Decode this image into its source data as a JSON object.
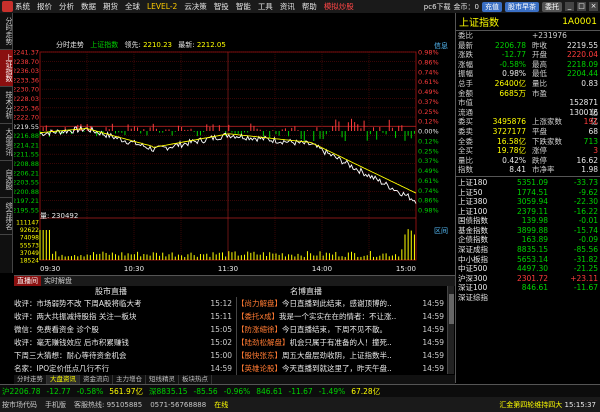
{
  "menu": [
    "系统",
    "报价",
    "分析",
    "数据",
    "期货",
    "全球",
    "LEVEL-2",
    "云决策",
    "智投",
    "智能",
    "工具",
    "资讯",
    "帮助",
    "模拟炒股"
  ],
  "menu_right": {
    "text1": "pc6下载",
    "text2": "金币：0",
    "btn1": "充值",
    "btn2": "股市早茶",
    "btn3": "委托"
  },
  "left_tabs": [
    "分时走势",
    "上证指数",
    "技术分析",
    "大盘资讯",
    "自选股",
    "综合排名"
  ],
  "chart": {
    "header": {
      "label1": "分时走势",
      "label2": "上证指数",
      "label3": "领先:",
      "value3": "2210.23",
      "label4": "最新:",
      "value4": "2212.05"
    },
    "top_right": "信息",
    "zoom": "区间",
    "price_ticks": [
      "2241.37",
      "2238.70",
      "2236.03",
      "2233.36",
      "2230.70",
      "2228.03",
      "2225.36",
      "2222.70",
      "2219.55",
      "2216.88",
      "2214.21",
      "2211.55",
      "2208.88",
      "2206.21",
      "2203.55",
      "2200.88",
      "2197.21",
      "2195.55"
    ],
    "pct_ticks": [
      "0.98%",
      "0.86%",
      "0.74%",
      "0.61%",
      "0.49%",
      "0.37%",
      "0.25%",
      "0.12%",
      "0.00%",
      "0.12%",
      "0.25%",
      "0.37%",
      "0.49%",
      "0.61%",
      "0.74%",
      "0.86%",
      "0.98%"
    ],
    "vol_label": "量: 230492",
    "vol_ticks": [
      "111147",
      "92622",
      "74098",
      "55573",
      "37049",
      "18524"
    ],
    "time_ticks": [
      "09:30",
      "10:30",
      "11:30",
      "14:00",
      "15:00"
    ]
  },
  "right_panel": {
    "title": "上证指数",
    "code": "1A0001",
    "rows": [
      {
        "l": "委比",
        "v": "",
        "l2": "+231976",
        "v2": "",
        "cls": "red",
        "cls2": "red"
      },
      {
        "l": "最新",
        "v": "2206.78",
        "l2": "昨收",
        "v2": "2219.55",
        "cls": "green",
        "cls2": "white"
      },
      {
        "l": "涨跌",
        "v": "-12.77",
        "l2": "开盘",
        "v2": "2220.04",
        "cls": "green",
        "cls2": "red"
      },
      {
        "l": "涨幅",
        "v": "-0.58%",
        "l2": "最高",
        "v2": "2218.09",
        "cls": "green",
        "cls2": "green"
      },
      {
        "l": "振幅",
        "v": "0.98%",
        "l2": "最低",
        "v2": "2204.44",
        "cls": "white",
        "cls2": "green"
      },
      {
        "l": "总手",
        "v": "26400亿",
        "l2": "量比",
        "v2": "0.83",
        "cls": "yellow",
        "cls2": "white"
      },
      {
        "l": "金额",
        "v": "6685万",
        "l2": "市盈",
        "v2": "",
        "cls": "yellow",
        "cls2": "white"
      },
      {
        "l": "市值",
        "v": "",
        "l2": "",
        "v2": "152871亿",
        "cls": "white",
        "cls2": "white"
      },
      {
        "l": "流通",
        "v": "",
        "l2": "",
        "v2": "130016亿",
        "cls": "white",
        "cls2": "white"
      },
      {
        "l": "委买",
        "v": "3495876",
        "l2": "上涨家数",
        "v2": "191",
        "cls": "yellow",
        "cls2": "red"
      },
      {
        "l": "委卖",
        "v": "3727177",
        "l2": "平盘",
        "v2": "68",
        "cls": "yellow",
        "cls2": "white"
      },
      {
        "l": "全委",
        "v": "16.58亿",
        "l2": "下跌家数",
        "v2": "713",
        "cls": "yellow",
        "cls2": "green"
      },
      {
        "l": "全买",
        "v": "19.78亿",
        "l2": "涨停",
        "v2": "3",
        "cls": "yellow",
        "cls2": "red"
      },
      {
        "l": "量比",
        "v": "0.42%",
        "l2": "跌停",
        "v2": "16.62",
        "cls": "white",
        "cls2": "white"
      },
      {
        "l": "指数",
        "v": "8.41",
        "l2": "市净率",
        "v2": "1.98",
        "cls": "white",
        "cls2": "white"
      }
    ],
    "indexes": [
      {
        "n": "上证180",
        "p": "5351.09",
        "c": "-33.73"
      },
      {
        "n": "上证50",
        "p": "1774.51",
        "c": "-9.62"
      },
      {
        "n": "上证380",
        "p": "3059.94",
        "c": "-22.30"
      },
      {
        "n": "上证100",
        "p": "2379.11",
        "c": "-16.22"
      },
      {
        "n": "国债指数",
        "p": "139.98",
        "c": "-0.01"
      },
      {
        "n": "基金指数",
        "p": "3899.88",
        "c": "-15.74"
      },
      {
        "n": "企债指数",
        "p": "163.89",
        "c": "-0.09"
      },
      {
        "n": "深证成指",
        "p": "8835.15",
        "c": "-85.56"
      },
      {
        "n": "中小板指",
        "p": "5653.14",
        "c": "-31.82"
      },
      {
        "n": "中证500",
        "p": "4497.30",
        "c": "-21.25"
      },
      {
        "n": "沪深300",
        "p": "2301.72",
        "c": "+23.11"
      },
      {
        "n": "深证100",
        "p": "846.61",
        "c": "-11.67"
      },
      {
        "n": "深证综指",
        "p": "",
        "c": ""
      }
    ]
  },
  "news_tabs": [
    "直播间",
    "实时解盘"
  ],
  "news_left_title": "股市直播",
  "news_right_title": "名博直播",
  "news_left": [
    {
      "t": "收评：市场弱势不改 下周A股将临大考",
      "tm": "15:12"
    },
    {
      "t": "收评：两大共振减持股指 关注一板块",
      "tm": "15:11"
    },
    {
      "t": "微信：免费看资金 诊个股",
      "tm": "15:05"
    },
    {
      "t": "收评：毫无赚钱效应 后市积累赚钱",
      "tm": "15:02"
    },
    {
      "t": "下周三大猜想：耐心等待资金机会",
      "tm": "15:00"
    },
    {
      "t": "名家：IPO定价低点几行不行",
      "tm": "14:59"
    }
  ],
  "news_right": [
    {
      "tag": "【尚力解盘】",
      "t": "今日直播到此结束，感谢顶博的..",
      "tm": "14:59"
    },
    {
      "tag": "【委托x成】",
      "t": "我是一个实实在在的情者：不让涨..",
      "tm": "14:59"
    },
    {
      "tag": "【防涨缩徐】",
      "t": "今日直播结束，下周不见不散。",
      "tm": "14:59"
    },
    {
      "tag": "【陆劲松解盘】",
      "t": "机会只属于有准备的人！撞死..",
      "tm": "14:59"
    },
    {
      "tag": "【股快张东】",
      "t": "周五大盘层劲收阴，上证指数半..",
      "tm": "14:59"
    },
    {
      "tag": "【英雄论股】",
      "t": "今天直播到就这里了，昨天午盘..",
      "tm": "14:59"
    }
  ],
  "bottom_tabs": [
    "分时走势",
    "大盘资讯",
    "资金流向",
    "主力增仓",
    "短线精灵",
    "板块热点"
  ],
  "status1": [
    {
      "t": "沪2206.78",
      "cls": "green"
    },
    {
      "t": "-12.77",
      "cls": "green"
    },
    {
      "t": "-0.58%",
      "cls": "green"
    },
    {
      "t": "561.97亿",
      "cls": "yellow"
    },
    {
      "t": "深8835.15",
      "cls": "green"
    },
    {
      "t": "-85.56",
      "cls": "green"
    },
    {
      "t": "-0.96%",
      "cls": "green"
    },
    {
      "t": "846.61",
      "cls": "green"
    },
    {
      "t": "-11.67",
      "cls": "green"
    },
    {
      "t": "-1.49%",
      "cls": "green"
    },
    {
      "t": "67.28亿",
      "cls": "yellow"
    }
  ],
  "status2": {
    "a": "按市场代码",
    "b": "手机版",
    "c": "客服热线: 95105885",
    "d": "0571-56768888",
    "warn": "在线",
    "right": "汇金第四轮维持四大",
    "time": "15:15:37"
  },
  "colors": {
    "up": "#ff3c3c",
    "down": "#00d200",
    "accent": "#8a1010"
  }
}
